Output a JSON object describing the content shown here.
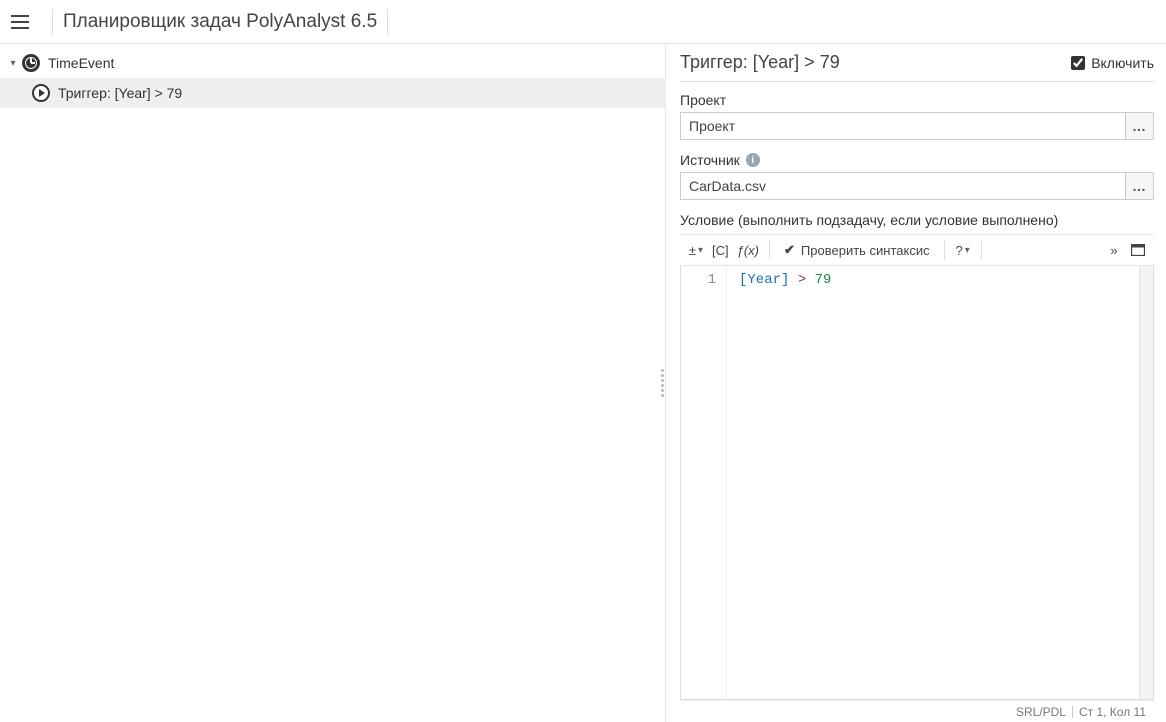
{
  "app": {
    "title": "Планировщик задач PolyAnalyst 6.5"
  },
  "tree": {
    "root": {
      "label": "TimeEvent",
      "child_label": "Триггер: [Year] > 79"
    }
  },
  "details": {
    "title": "Триггер: [Year] > 79",
    "enable_label": "Включить",
    "enabled": true,
    "project_label": "Проект",
    "project_value": "Проект",
    "source_label": "Источник",
    "source_value": "CarData.csv",
    "condition_label": "Условие (выполнить подзадачу, если условие выполнено)",
    "browse_label": "…"
  },
  "toolbar": {
    "plusminus": "±",
    "brackets": "[C]",
    "fx": "ƒ(x)",
    "check_label": "Проверить синтаксис",
    "help": "?",
    "more": "»"
  },
  "editor": {
    "line_number": "1",
    "code_column": "[Year]",
    "code_op": ">",
    "code_num": "79"
  },
  "status": {
    "lang": "SRL/PDL",
    "pos": "Ст 1, Кол 11"
  }
}
